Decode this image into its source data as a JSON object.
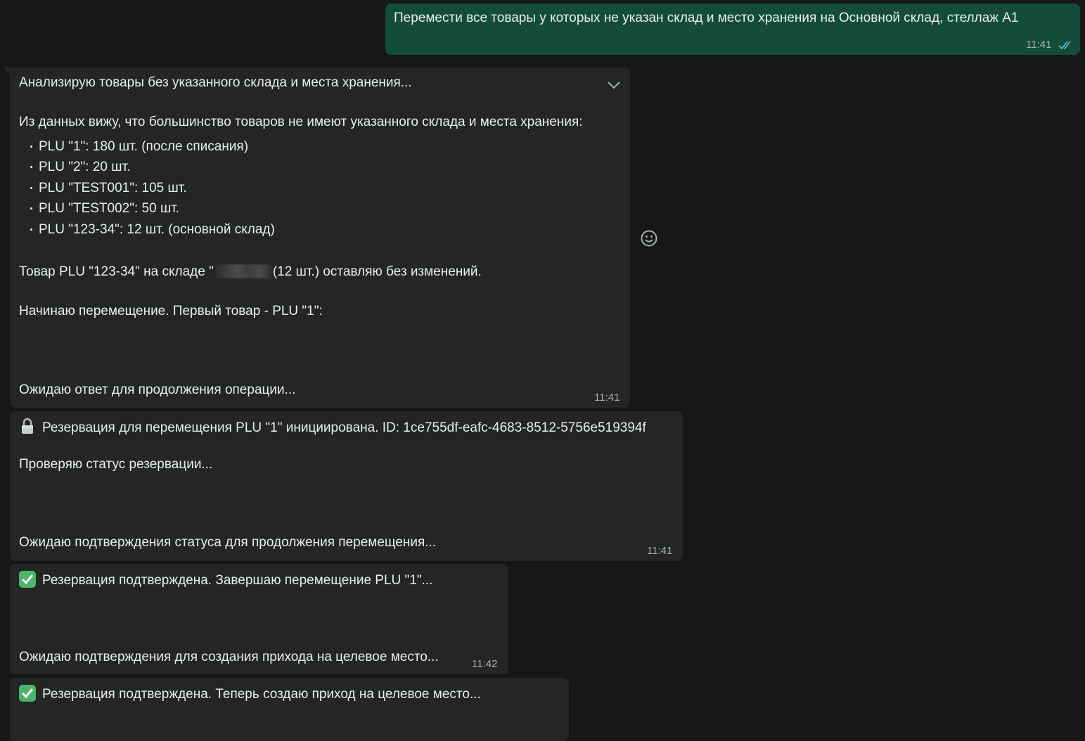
{
  "user_message": {
    "text": "Перемести все товары у которых не указан склад и место хранения на Основной склад, стеллаж А1",
    "time": "11:41"
  },
  "bot_message_1": {
    "line1": "Анализирую товары без указанного склада и места хранения...",
    "line2": "Из данных вижу, что большинство товаров не имеют указанного склада и места хранения:",
    "items": [
      "PLU \"1\": 180 шт. (после списания)",
      "PLU \"2\": 20 шт.",
      "PLU \"TEST001\": 105 шт.",
      "PLU \"TEST002\": 50 шт.",
      "PLU \"123-34\": 12 шт. (основной склад)"
    ],
    "line3_before": "Товар PLU \"123-34\" на складе \"",
    "line3_after": "(12 шт.) оставляю без изменений.",
    "line4": "Начинаю перемещение. Первый товар - PLU \"1\":",
    "line5": "Ожидаю ответ для продолжения операции...",
    "time": "11:41"
  },
  "bot_message_2": {
    "line1": "Резервация для перемещения PLU \"1\" инициирована. ID: 1ce755df-eafc-4683-8512-5756e519394f",
    "line2": "Проверяю статус резервации...",
    "line3": "Ожидаю подтверждения статуса для продолжения перемещения...",
    "time": "11:41"
  },
  "bot_message_3": {
    "line1": "Резервация подтверждена. Завершаю перемещение PLU \"1\"...",
    "line2": "Ожидаю подтверждения для создания прихода на целевое место...",
    "time": "11:42"
  },
  "bot_message_4": {
    "line1": "Резервация подтверждена. Теперь создаю приход на целевое место..."
  },
  "colors": {
    "background": "#161717",
    "incoming_bubble": "#242626",
    "outgoing_bubble": "#144d37",
    "read_ticks": "#53bdeb"
  }
}
